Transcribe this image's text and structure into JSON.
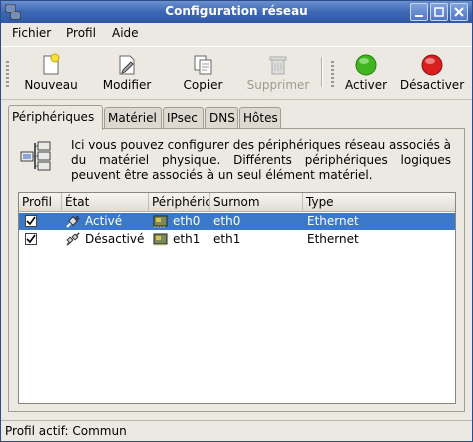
{
  "window": {
    "title": "Configuration réseau"
  },
  "menu": [
    {
      "label": "Fichier"
    },
    {
      "label": "Profil"
    },
    {
      "label": "Aide"
    }
  ],
  "toolbar": {
    "new_label": "Nouveau",
    "edit_label": "Modifier",
    "copy_label": "Copier",
    "delete_label": "Supprimer",
    "activate_label": "Activer",
    "deactivate_label": "Désactiver"
  },
  "tabs": [
    {
      "label": "Périphériques",
      "active": true
    },
    {
      "label": "Matériel"
    },
    {
      "label": "IPsec"
    },
    {
      "label": "DNS"
    },
    {
      "label": "Hôtes"
    }
  ],
  "description": "Ici vous pouvez configurer des périphériques réseau associés à du matériel physique. Différents périphériques logiques peuvent être associés à un seul élément matériel.",
  "table": {
    "columns": [
      "Profil",
      "État",
      "Périphéric",
      "Surnom",
      "Type"
    ],
    "rows": [
      {
        "profile": true,
        "state": "Activé",
        "device": "eth0",
        "nickname": "eth0",
        "type": "Ethernet",
        "selected": true
      },
      {
        "profile": true,
        "state": "Désactivé",
        "device": "eth1",
        "nickname": "eth1",
        "type": "Ethernet",
        "selected": false
      }
    ]
  },
  "status": {
    "text": "Profil actif: Commun"
  },
  "colors": {
    "titlebar": "#3e68b5",
    "selection": "#3b78c9",
    "activate": "#3fb51f",
    "deactivate": "#d81f1f"
  }
}
